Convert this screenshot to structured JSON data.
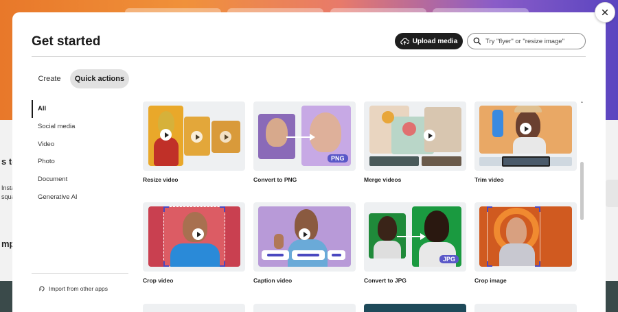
{
  "background": {
    "partial_labels": [
      "s to",
      "Insta",
      "squa",
      "mp"
    ],
    "colors": {
      "hero_start": "#e8782a",
      "hero_end": "#5a45c0"
    }
  },
  "modal": {
    "title": "Get started",
    "upload_label": "Upload media",
    "search_placeholder": "Try \"flyer\" or \"resize image\"",
    "tabs": [
      {
        "label": "Create",
        "active": false
      },
      {
        "label": "Quick actions",
        "active": true
      }
    ],
    "sidebar": {
      "items": [
        {
          "label": "All",
          "active": true
        },
        {
          "label": "Social media",
          "active": false
        },
        {
          "label": "Video",
          "active": false
        },
        {
          "label": "Photo",
          "active": false
        },
        {
          "label": "Document",
          "active": false
        },
        {
          "label": "Generative AI",
          "active": false
        }
      ],
      "import_label": "Import from other apps"
    },
    "cards": [
      {
        "label": "Resize video",
        "icon": "play-icon"
      },
      {
        "label": "Convert to PNG",
        "badge": "PNG"
      },
      {
        "label": "Merge videos",
        "icon": "play-icon"
      },
      {
        "label": "Trim video",
        "icon": "play-icon"
      },
      {
        "label": "Crop video",
        "icon": "play-icon"
      },
      {
        "label": "Caption video",
        "icon": "play-icon"
      },
      {
        "label": "Convert to JPG",
        "badge": "JPG"
      },
      {
        "label": "Crop image",
        "icon": "crop-frame-icon"
      }
    ],
    "accent_color": "#5a58c8"
  }
}
